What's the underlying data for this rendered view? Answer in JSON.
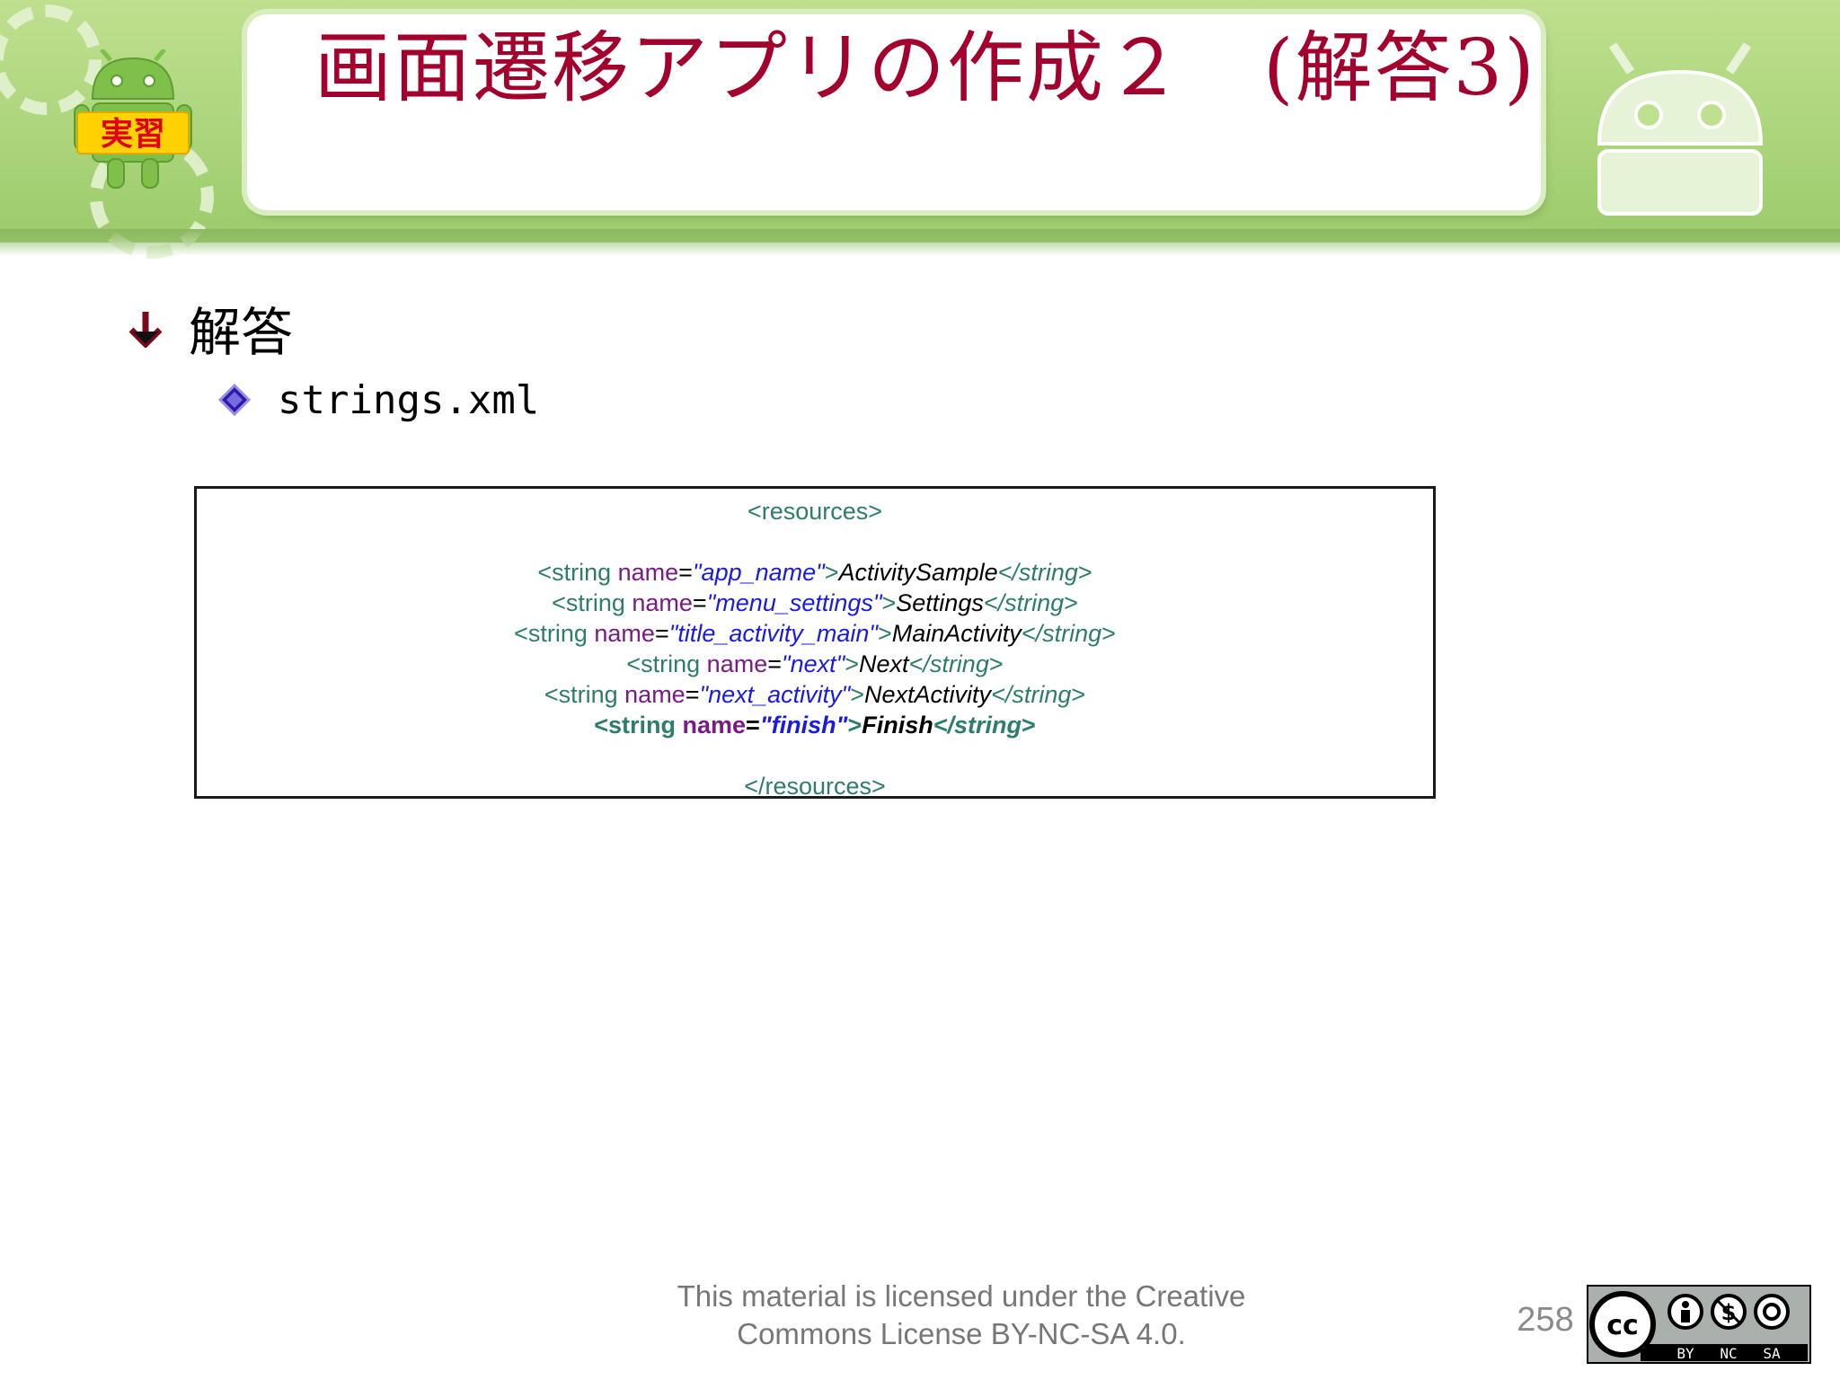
{
  "header": {
    "title": "画面遷移アプリの作成２　(解答3)",
    "badge_label": "実習"
  },
  "bullets": {
    "level1": "解答",
    "level2": "strings.xml"
  },
  "code": {
    "lines": [
      {
        "kind": "tag",
        "text": "<resources>"
      },
      {
        "kind": "blank"
      },
      {
        "kind": "string",
        "name": "app_name",
        "value": "ActivitySample"
      },
      {
        "kind": "string",
        "name": "menu_settings",
        "value": "Settings"
      },
      {
        "kind": "string",
        "name": "title_activity_main",
        "value": "MainActivity"
      },
      {
        "kind": "string",
        "name": "next",
        "value": "Next"
      },
      {
        "kind": "string",
        "name": "next_activity",
        "value": "NextActivity"
      },
      {
        "kind": "string",
        "name": "finish",
        "value": "Finish",
        "bold": true
      },
      {
        "kind": "blank"
      },
      {
        "kind": "tag",
        "text": "</resources>"
      }
    ]
  },
  "footer": {
    "license_line1": "This material is licensed under the Creative",
    "license_line2": "Commons License BY-NC-SA 4.0.",
    "page_number": "258",
    "cc_labels": [
      "BY",
      "NC",
      "SA"
    ]
  },
  "colors": {
    "title": "#a3002e",
    "banner": "#aad47a",
    "tag": "#2e7d6b",
    "attr": "#7a1a86",
    "value": "#1a1ae0"
  }
}
